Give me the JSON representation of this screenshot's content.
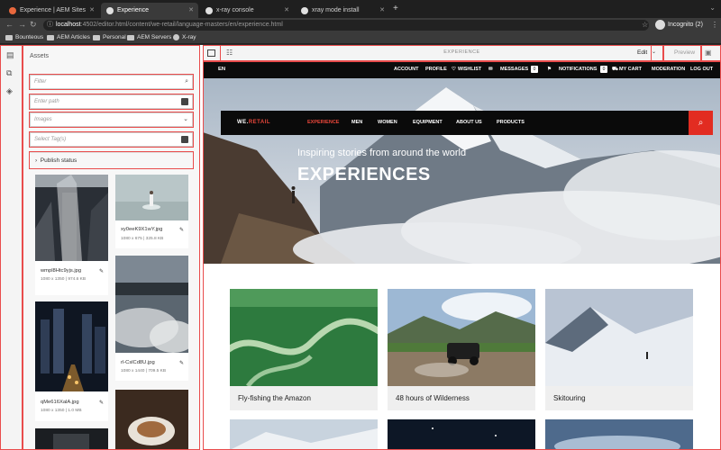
{
  "browser": {
    "tabs": [
      {
        "label": "Experience | AEM Sites",
        "active": false
      },
      {
        "label": "Experience",
        "active": true
      },
      {
        "label": "x-ray console",
        "active": false
      },
      {
        "label": "xray mode install",
        "active": false
      }
    ],
    "new_tab": "+",
    "url_host": "localhost",
    "url_path": ":4502/editor.html/content/we-retail/language-masters/en/experience.html",
    "profile": "Incognito (2)",
    "bookmarks": [
      "Bounteous",
      "AEM Articles",
      "Personal",
      "AEM Servers",
      "X-ray"
    ]
  },
  "sidepanel": {
    "title": "Assets",
    "filter_placeholder": "Filter",
    "path_placeholder": "Enter path",
    "type_value": "Images",
    "tags_placeholder": "Select Tag(s)",
    "publish_status": "Publish status",
    "assets": [
      {
        "name": "wmpl8Htc9yjs.jpg",
        "meta": "1080 x 1350 | 974.6 KB"
      },
      {
        "name": "xy0eeK9X1wY.jpg",
        "meta": "1080 x 675 | 325.8 KB"
      },
      {
        "name": "qMe616XalA.jpg",
        "meta": "1080 x 1350 | 1.0 MB"
      },
      {
        "name": "rl-CslCd8U.jpg",
        "meta": "1080 x 1440 | 709.5 KB"
      }
    ]
  },
  "toolbar": {
    "title": "EXPERIENCE",
    "edit_label": "Edit",
    "preview_label": "Preview"
  },
  "site": {
    "lang": "EN",
    "topnav": [
      "ACCOUNT",
      "PROFILE",
      "WISHLIST",
      "MESSAGES",
      "NOTIFICATIONS",
      "MY CART",
      "MODERATION",
      "LOG OUT"
    ],
    "messages_count": "0",
    "notifications_count": "0",
    "brand_prefix": "WE.",
    "brand_suffix": "RETAIL",
    "mainnav": [
      "EXPERIENCE",
      "MEN",
      "WOMEN",
      "EQUIPMENT",
      "ABOUT US",
      "PRODUCTS"
    ],
    "hero_sub": "Inspiring stories from around the world",
    "hero_title": "EXPERIENCES",
    "cards": [
      "Fly-fishing the Amazon",
      "48 hours of Wilderness",
      "Skitouring"
    ]
  },
  "colors": {
    "accent": "#e22c21",
    "outline": "#e94c4c"
  }
}
